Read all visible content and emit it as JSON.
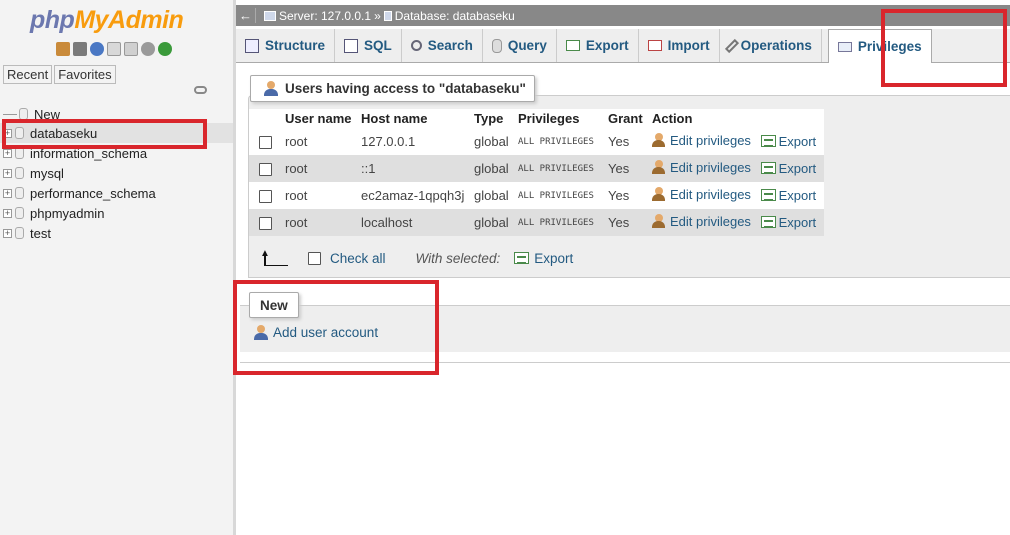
{
  "logo": {
    "part1": "php",
    "part2": "MyAdmin"
  },
  "sidebar": {
    "recent_label": "Recent",
    "favorites_label": "Favorites",
    "tree": [
      {
        "label": "New",
        "kind": "new"
      },
      {
        "label": "databaseku",
        "kind": "db",
        "active": true
      },
      {
        "label": "information_schema",
        "kind": "db"
      },
      {
        "label": "mysql",
        "kind": "db"
      },
      {
        "label": "performance_schema",
        "kind": "db"
      },
      {
        "label": "phpmyadmin",
        "kind": "db"
      },
      {
        "label": "test",
        "kind": "db"
      }
    ]
  },
  "topbar": {
    "back": "←",
    "server": "Server: 127.0.0.1",
    "separator": "»",
    "database": "Database: databaseku"
  },
  "menu": {
    "tabs": [
      {
        "label": "Structure"
      },
      {
        "label": "SQL"
      },
      {
        "label": "Search"
      },
      {
        "label": "Query"
      },
      {
        "label": "Export"
      },
      {
        "label": "Import"
      },
      {
        "label": "Operations"
      },
      {
        "label": "Privileges",
        "active": true
      }
    ]
  },
  "users_panel": {
    "legend": "Users having access to \"databaseku\"",
    "headers": [
      "User name",
      "Host name",
      "Type",
      "Privileges",
      "Grant",
      "Action"
    ],
    "rows": [
      {
        "user": "root",
        "host": "127.0.0.1",
        "type": "global",
        "privileges": "ALL PRIVILEGES",
        "grant": "Yes",
        "edit": "Edit privileges",
        "export": "Export"
      },
      {
        "user": "root",
        "host": "::1",
        "type": "global",
        "privileges": "ALL PRIVILEGES",
        "grant": "Yes",
        "edit": "Edit privileges",
        "export": "Export"
      },
      {
        "user": "root",
        "host": "ec2amaz-1qpqh3j",
        "type": "global",
        "privileges": "ALL PRIVILEGES",
        "grant": "Yes",
        "edit": "Edit privileges",
        "export": "Export"
      },
      {
        "user": "root",
        "host": "localhost",
        "type": "global",
        "privileges": "ALL PRIVILEGES",
        "grant": "Yes",
        "edit": "Edit privileges",
        "export": "Export"
      }
    ],
    "check_all": "Check all",
    "with_selected": "With selected:",
    "export": "Export"
  },
  "new_panel": {
    "legend": "New",
    "add_user": "Add user account"
  },
  "annotation_color": "#d9262c"
}
